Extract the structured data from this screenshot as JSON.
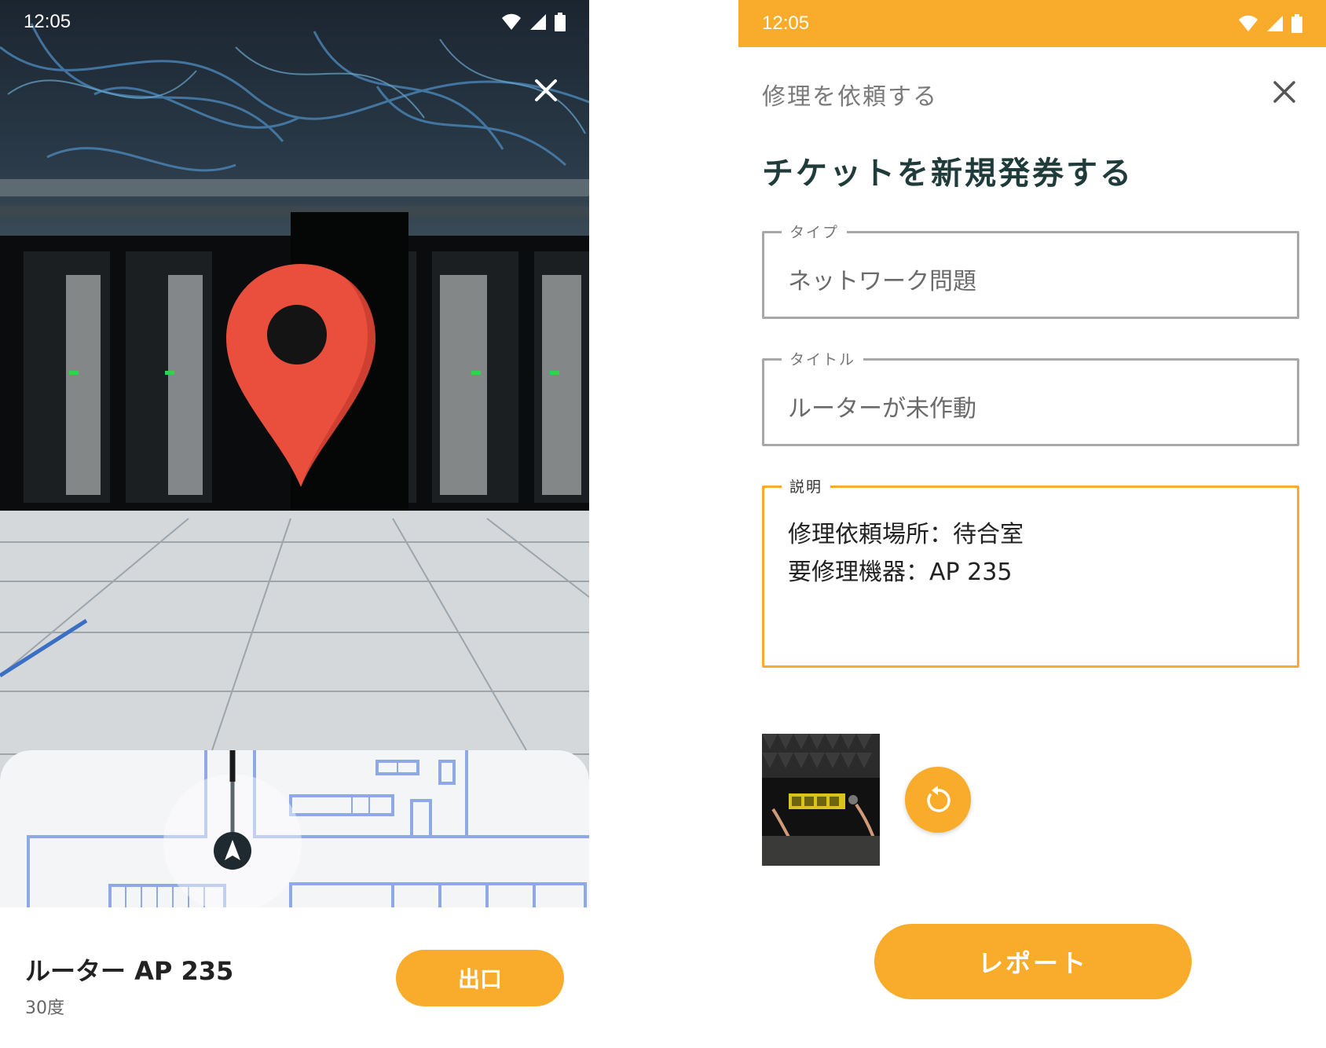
{
  "left_screen": {
    "status_bar": {
      "time": "12:05"
    },
    "device": {
      "name": "ルーター AP 235",
      "angle": "30度"
    },
    "exit_label": "出口"
  },
  "right_screen": {
    "status_bar": {
      "time": "12:05"
    },
    "header_title": "修理を依頼する",
    "form_heading": "チケットを新規発券する",
    "fields": {
      "type": {
        "label": "タイプ",
        "value": "ネットワーク問題"
      },
      "title": {
        "label": "タイトル",
        "value": "ルーターが未作動"
      },
      "description": {
        "label": "説明",
        "value": "修理依頼場所：待合室\n要修理機器：AP 235"
      }
    },
    "report_label": "レポート"
  },
  "colors": {
    "accent": "#f9ac2b",
    "pin": "#ea4e3d",
    "heading": "#1f3b3a"
  },
  "icons": [
    "wifi-icon",
    "cell-signal-icon",
    "battery-icon",
    "close-icon",
    "location-pin-icon",
    "navigation-arrow-icon",
    "retake-icon"
  ]
}
